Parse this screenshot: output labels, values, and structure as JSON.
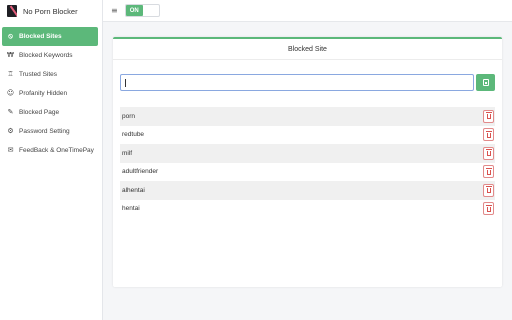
{
  "app": {
    "title": "No Porn Blocker"
  },
  "topbar": {
    "toggle_label": "ON"
  },
  "sidebar": {
    "items": [
      {
        "label": "Blocked Sites",
        "icon": "ban-icon",
        "active": true
      },
      {
        "label": "Blocked Keywords",
        "icon": "keywords-icon",
        "active": false
      },
      {
        "label": "Trusted Sites",
        "icon": "award-icon",
        "active": false
      },
      {
        "label": "Profanity Hidden",
        "icon": "smile-icon",
        "active": false
      },
      {
        "label": "Blocked Page",
        "icon": "edit-icon",
        "active": false
      },
      {
        "label": "Password Setting",
        "icon": "gears-icon",
        "active": false
      },
      {
        "label": "FeedBack & OneTimePay",
        "icon": "chat-icon",
        "active": false
      }
    ]
  },
  "main": {
    "card_title": "Blocked Site",
    "input": {
      "value": "",
      "placeholder": ""
    },
    "add_icon": "add-icon",
    "delete_icon": "trash-icon",
    "sites": [
      "porn",
      "redtube",
      "milf",
      "adultfriender",
      "alhentai",
      "hentai"
    ]
  },
  "colors": {
    "accent": "#5cb87a",
    "danger": "#d9534f",
    "input_border": "#8aa8e0"
  }
}
